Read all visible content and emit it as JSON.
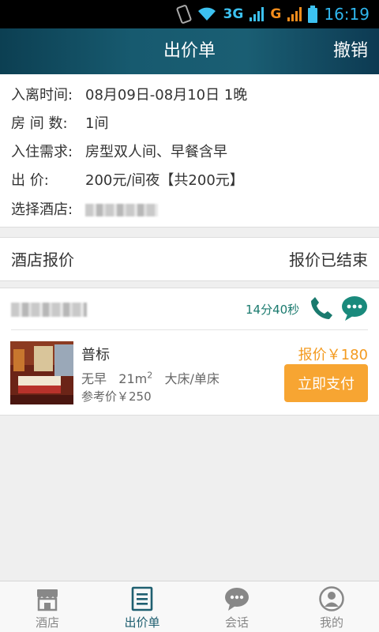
{
  "status_bar": {
    "network_3g": "3G",
    "network_g": "G",
    "time": "16:19"
  },
  "header": {
    "title": "出价单",
    "action": "撤销"
  },
  "info": {
    "rows": [
      {
        "label": "入离时间:",
        "value": "08月09日-08月10日  1晚"
      },
      {
        "label": "房 间 数:",
        "value": "1间"
      },
      {
        "label": "入住需求:",
        "value": "房型双人间、早餐含早"
      },
      {
        "label": "出      价:",
        "value": "200元/间夜【共200元】"
      },
      {
        "label": "选择酒店:",
        "value": ""
      }
    ]
  },
  "section": {
    "title": "酒店报价",
    "status": "报价已结束"
  },
  "offer": {
    "timer": "14分40秒",
    "room_name": "普标",
    "spec_breakfast": "无早",
    "spec_area": "21m",
    "spec_area_unit_sup": "2",
    "spec_bed": "大床/单床",
    "reference_price": "参考价￥250",
    "offer_price": "报价￥180",
    "pay_label": "立即支付"
  },
  "bottom_nav": {
    "items": [
      {
        "label": "酒店",
        "icon": "store-icon"
      },
      {
        "label": "出价单",
        "icon": "list-icon"
      },
      {
        "label": "会话",
        "icon": "chat-icon"
      },
      {
        "label": "我的",
        "icon": "user-icon"
      }
    ],
    "active_index": 1
  },
  "colors": {
    "header_start": "#0c3f52",
    "accent_orange": "#f7a532",
    "teal": "#1a7a6e",
    "active_nav": "#1f5f70"
  }
}
